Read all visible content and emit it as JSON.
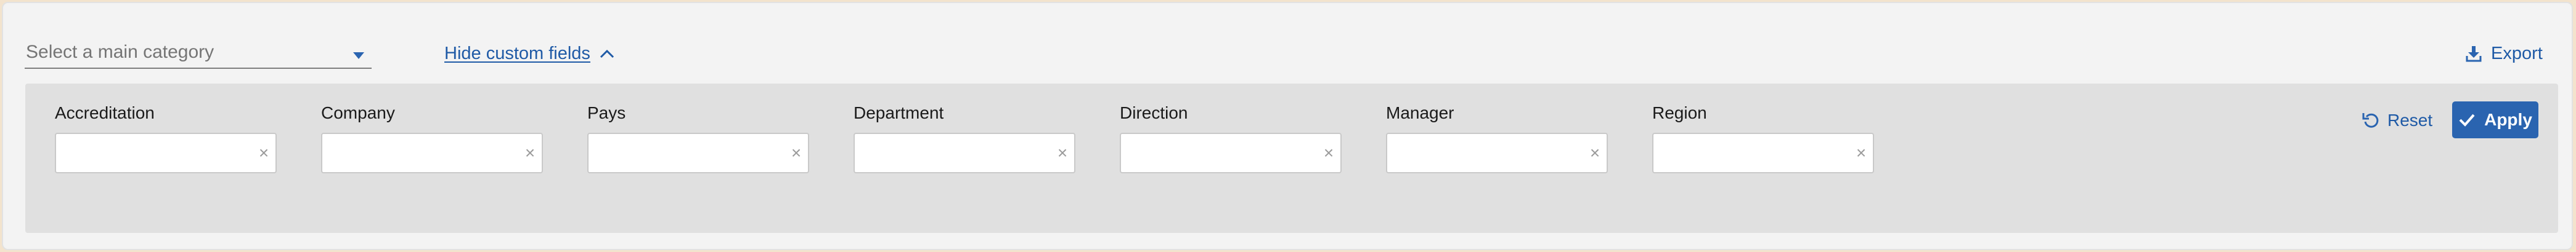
{
  "category_select": {
    "placeholder": "Select a main category",
    "icon": "chevron-down-icon"
  },
  "custom_fields_toggle": {
    "label": "Hide custom fields",
    "icon": "chevron-up-icon"
  },
  "export": {
    "label": "Export",
    "icon": "download-icon"
  },
  "filters": [
    {
      "label": "Accreditation",
      "value": ""
    },
    {
      "label": "Company",
      "value": ""
    },
    {
      "label": "Pays",
      "value": ""
    },
    {
      "label": "Department",
      "value": ""
    },
    {
      "label": "Direction",
      "value": ""
    },
    {
      "label": "Manager",
      "value": ""
    },
    {
      "label": "Region",
      "value": ""
    }
  ],
  "clear_glyph": "×",
  "actions": {
    "reset_label": "Reset",
    "reset_icon": "undo-icon",
    "apply_label": "Apply",
    "apply_icon": "check-icon"
  },
  "colors": {
    "accent": "#2a64b0",
    "link": "#1f5aa6",
    "panel_bg": "#f3f3f3",
    "filters_bg": "#e0e0e0"
  }
}
